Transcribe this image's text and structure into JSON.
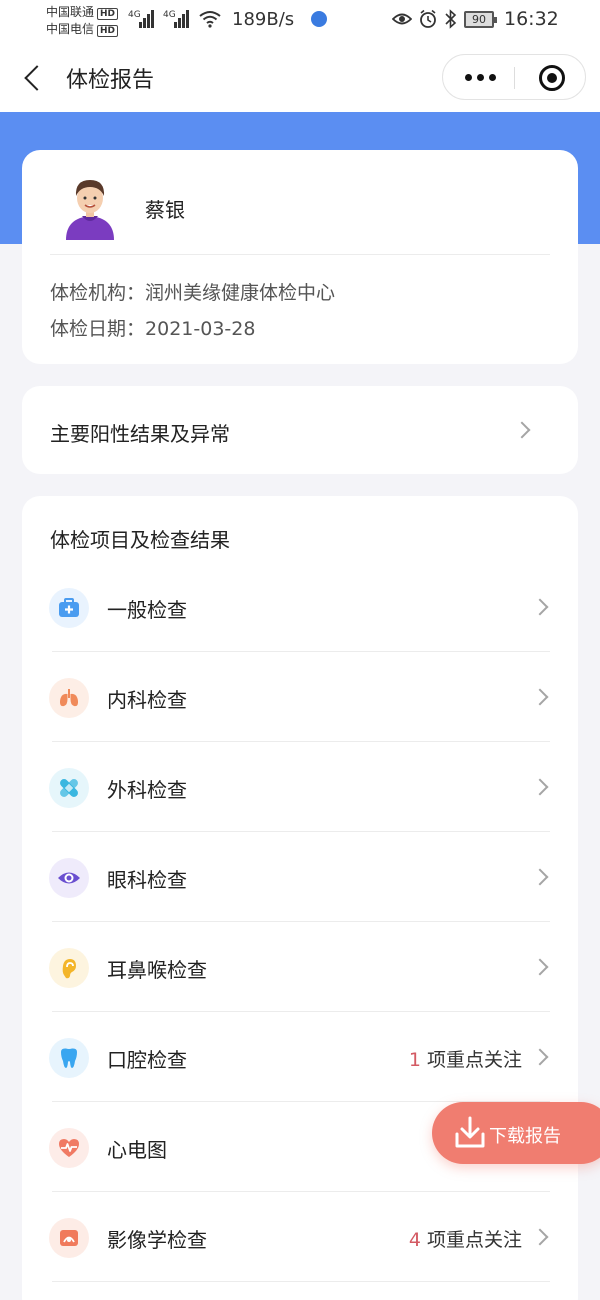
{
  "status_bar": {
    "carrier1": "中国联通",
    "carrier2": "中国电信",
    "hd": "HD",
    "net1": "4G",
    "net2": "4G",
    "speed": "189B/s",
    "battery": "90",
    "time": "16:32"
  },
  "nav": {
    "title": "体检报告",
    "back_icon": "chevron-left-icon",
    "more_icon": "more-dots-icon",
    "close_icon": "target-icon"
  },
  "profile": {
    "name": "蔡银",
    "institution_label": "体检机构：",
    "institution": "润州美缘健康体检中心",
    "date_label": "体检日期：",
    "date": "2021-03-28"
  },
  "abnormal": {
    "label": "主要阳性结果及异常"
  },
  "items_section": {
    "title": "体检项目及检查结果",
    "items": [
      {
        "label": "一般检查",
        "icon": "medical-kit-icon",
        "color": "#4a9cf0",
        "bg": "#e9f3fe",
        "count": "",
        "note": ""
      },
      {
        "label": "内科检查",
        "icon": "lungs-icon",
        "color": "#f08a5a",
        "bg": "#fdeee6",
        "count": "",
        "note": ""
      },
      {
        "label": "外科检查",
        "icon": "bandage-icon",
        "color": "#3ab7e0",
        "bg": "#e6f6fb",
        "count": "",
        "note": ""
      },
      {
        "label": "眼科检查",
        "icon": "eye-icon",
        "color": "#6a4fd0",
        "bg": "#efebfb",
        "count": "",
        "note": ""
      },
      {
        "label": "耳鼻喉检查",
        "icon": "ear-icon",
        "color": "#f3b52a",
        "bg": "#fdf4df",
        "count": "",
        "note": ""
      },
      {
        "label": "口腔检查",
        "icon": "tooth-icon",
        "color": "#3aa6f0",
        "bg": "#e7f4fd",
        "count": "1",
        "note": "项重点关注"
      },
      {
        "label": "心电图",
        "icon": "heartbeat-icon",
        "color": "#f07a64",
        "bg": "#fdece8",
        "count": "",
        "note": ""
      },
      {
        "label": "影像学检查",
        "icon": "ultrasound-icon",
        "color": "#f07a5c",
        "bg": "#fdece6",
        "count": "4",
        "note": "项重点关注"
      }
    ]
  },
  "download": {
    "label": "下载报告",
    "icon": "download-icon",
    "color": "#f07d70"
  }
}
